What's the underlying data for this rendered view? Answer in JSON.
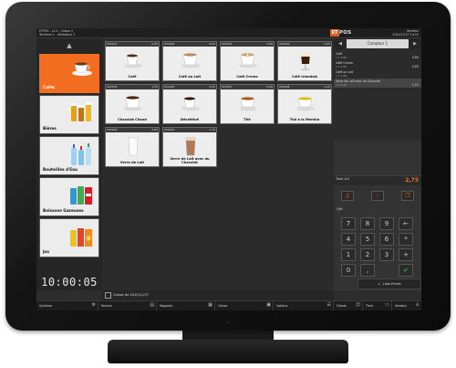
{
  "header": {
    "left_line1": "ETPOS - v1.0 - Caisse 2",
    "left_line2": "Terminal 1 - Utilisateur 1",
    "logo_box": "ET",
    "logo_text": "POS",
    "right_line1": "Vendeur",
    "right_line2": "2010/11/27 14:10"
  },
  "categories": [
    {
      "label": "Cafés",
      "active": true
    },
    {
      "label": "Bières",
      "active": false
    },
    {
      "label": "Bouteilles d'Eau",
      "active": false
    },
    {
      "label": "Boissons Gazeuses",
      "active": false
    },
    {
      "label": "Jus",
      "active": false
    }
  ],
  "scroll_up": "▲",
  "clock": "10:00:05",
  "products": [
    {
      "code": "000001",
      "price": "0,65",
      "name": "Café"
    },
    {
      "code": "000002",
      "price": "0,65",
      "name": "Café au Lait"
    },
    {
      "code": "000003",
      "price": "0,65",
      "name": "Café Crema"
    },
    {
      "code": "000004",
      "price": "0,65",
      "name": "Café Irlandais"
    },
    {
      "code": "000005",
      "price": "1,25",
      "name": "Chocolat Chaud"
    },
    {
      "code": "000006",
      "price": "0,95",
      "name": "Déca­féiné"
    },
    {
      "code": "000007",
      "price": "0,90",
      "name": "Thé"
    },
    {
      "code": "000008",
      "price": "1,25",
      "name": "Thé à la Menthe"
    },
    {
      "code": "000009",
      "price": "0,65",
      "name": "Verre de Lait"
    },
    {
      "code": "000010",
      "price": "1,10",
      "name": "Verre de Lait avec du Chocolat"
    }
  ],
  "order": {
    "tab_label": "Comptoir 1",
    "lines": [
      {
        "name": "Café",
        "qty": "x 1  0,65",
        "amount": "0,65",
        "selected": false
      },
      {
        "name": "Café Crema",
        "qty": "x 1  0,65",
        "amount": "0,65",
        "selected": false
      },
      {
        "name": "Café au Lait",
        "qty": "x 1  0,65",
        "amount": "",
        "selected": false
      },
      {
        "name": "Verre de Lait avec du Chocolat",
        "qty": "x 1  1,10",
        "amount": "1,10",
        "selected": true
      }
    ],
    "total_label": "Total #4",
    "total_value": "2,75",
    "qty_label": "Qté",
    "pay_label": "1 - Liste Privée"
  },
  "keypad": [
    "7",
    "8",
    "9",
    "←",
    "4",
    "5",
    "6",
    "*",
    "1",
    "2",
    "3",
    "+",
    "0",
    ",",
    "✔"
  ],
  "status": {
    "text": "Caisse de 2010/11/27"
  },
  "menu": [
    {
      "label": "Système",
      "icon": "gear-icon"
    },
    {
      "label": "Facture",
      "icon": "receipt-icon"
    },
    {
      "label": "Rapports",
      "icon": "chart-icon"
    },
    {
      "label": "Caisse",
      "icon": "register-icon"
    },
    {
      "label": "Options",
      "icon": "options-icon"
    },
    {
      "label": "Clients",
      "icon": "clients-icon"
    },
    {
      "label": "Tiroir",
      "icon": "drawer-icon"
    },
    {
      "label": "Vendeur",
      "icon": "user-icon"
    }
  ],
  "colors": {
    "accent": "#f36d21",
    "ok": "#2fae52"
  }
}
